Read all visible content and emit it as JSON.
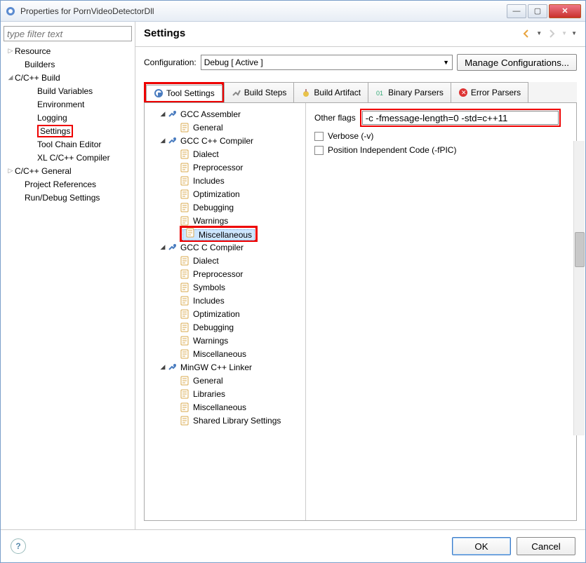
{
  "window": {
    "title": "Properties for PornVideoDetectorDll"
  },
  "left": {
    "filter_placeholder": "type filter text",
    "items": [
      {
        "d": 0,
        "exp": "▷",
        "label": "Resource"
      },
      {
        "d": 1,
        "exp": "",
        "label": "Builders"
      },
      {
        "d": 0,
        "exp": "◢",
        "label": "C/C++ Build"
      },
      {
        "d": 2,
        "exp": "",
        "label": "Build Variables"
      },
      {
        "d": 2,
        "exp": "",
        "label": "Environment"
      },
      {
        "d": 2,
        "exp": "",
        "label": "Logging"
      },
      {
        "d": 2,
        "exp": "",
        "label": "Settings",
        "hl": true
      },
      {
        "d": 2,
        "exp": "",
        "label": "Tool Chain Editor"
      },
      {
        "d": 2,
        "exp": "",
        "label": "XL C/C++ Compiler"
      },
      {
        "d": 0,
        "exp": "▷",
        "label": "C/C++ General"
      },
      {
        "d": 1,
        "exp": "",
        "label": "Project References"
      },
      {
        "d": 1,
        "exp": "",
        "label": "Run/Debug Settings"
      }
    ]
  },
  "header": {
    "title": "Settings"
  },
  "config": {
    "label": "Configuration:",
    "value": "Debug  [ Active ]",
    "manage": "Manage Configurations..."
  },
  "tabs": [
    {
      "label": "Tool Settings",
      "active": true,
      "hl": true
    },
    {
      "label": "Build Steps"
    },
    {
      "label": "Build Artifact"
    },
    {
      "label": "Binary Parsers"
    },
    {
      "label": "Error Parsers"
    }
  ],
  "tooltree": [
    {
      "d": 1,
      "exp": "◢",
      "icon": "tool",
      "label": "GCC Assembler"
    },
    {
      "d": 2,
      "icon": "page",
      "label": "General"
    },
    {
      "d": 1,
      "exp": "◢",
      "icon": "tool",
      "label": "GCC C++ Compiler"
    },
    {
      "d": 2,
      "icon": "page",
      "label": "Dialect"
    },
    {
      "d": 2,
      "icon": "page",
      "label": "Preprocessor"
    },
    {
      "d": 2,
      "icon": "page",
      "label": "Includes"
    },
    {
      "d": 2,
      "icon": "page",
      "label": "Optimization"
    },
    {
      "d": 2,
      "icon": "page",
      "label": "Debugging"
    },
    {
      "d": 2,
      "icon": "page",
      "label": "Warnings"
    },
    {
      "d": 2,
      "icon": "page",
      "label": "Miscellaneous",
      "sel": true,
      "hl": true
    },
    {
      "d": 1,
      "exp": "◢",
      "icon": "tool",
      "label": "GCC C Compiler"
    },
    {
      "d": 2,
      "icon": "page",
      "label": "Dialect"
    },
    {
      "d": 2,
      "icon": "page",
      "label": "Preprocessor"
    },
    {
      "d": 2,
      "icon": "page",
      "label": "Symbols"
    },
    {
      "d": 2,
      "icon": "page",
      "label": "Includes"
    },
    {
      "d": 2,
      "icon": "page",
      "label": "Optimization"
    },
    {
      "d": 2,
      "icon": "page",
      "label": "Debugging"
    },
    {
      "d": 2,
      "icon": "page",
      "label": "Warnings"
    },
    {
      "d": 2,
      "icon": "page",
      "label": "Miscellaneous"
    },
    {
      "d": 1,
      "exp": "◢",
      "icon": "tool",
      "label": "MinGW C++ Linker"
    },
    {
      "d": 2,
      "icon": "page",
      "label": "General"
    },
    {
      "d": 2,
      "icon": "page",
      "label": "Libraries"
    },
    {
      "d": 2,
      "icon": "page",
      "label": "Miscellaneous"
    },
    {
      "d": 2,
      "icon": "page",
      "label": "Shared Library Settings"
    }
  ],
  "form": {
    "other_flags_label": "Other flags",
    "other_flags_value": "-c -fmessage-length=0 -std=c++11",
    "verbose_label": "Verbose (-v)",
    "pic_label": "Position Independent Code (-fPIC)"
  },
  "footer": {
    "ok": "OK",
    "cancel": "Cancel"
  }
}
